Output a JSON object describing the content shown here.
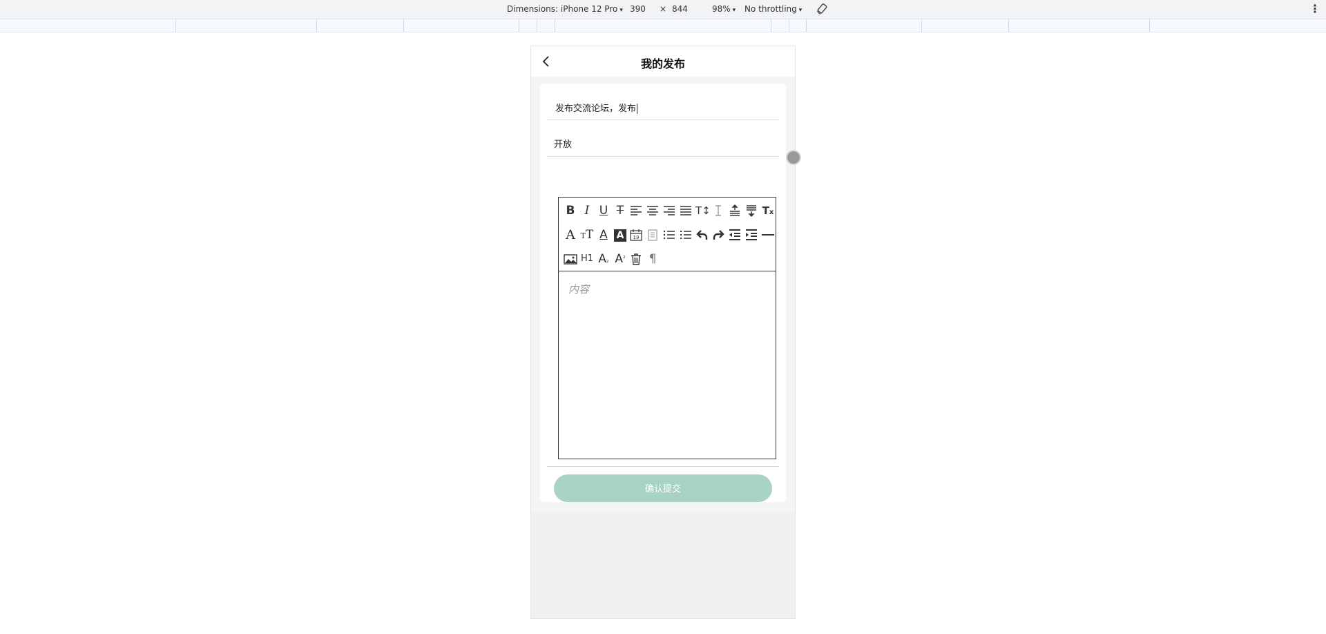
{
  "devtools": {
    "dimensions_label": "Dimensions: iPhone 12 Pro",
    "width": "390",
    "times": "×",
    "height": "844",
    "zoom": "98%",
    "throttling": "No throttling",
    "caret": "▾",
    "more": "⋮"
  },
  "nav": {
    "title": "我的发布"
  },
  "form": {
    "title_value": "发布交流论坛，发布",
    "status_value": "开放",
    "editor_placeholder": "内容",
    "submit_label": "确认提交"
  },
  "toolbar": {
    "row1": [
      "bold-icon",
      "italic-icon",
      "underline-icon",
      "strikethrough-icon",
      "align-left-icon",
      "align-center-icon",
      "align-right-icon",
      "align-justify-icon",
      "font-size-icon",
      "line-height-icon",
      "paragraph-spacing-above-icon",
      "paragraph-spacing-below-icon",
      "clear-format-icon"
    ],
    "row2": [
      "font-family-icon",
      "text-size-icon",
      "font-color-icon",
      "background-color-icon",
      "date-icon",
      "template-icon",
      "ordered-list-icon",
      "unordered-list-icon",
      "undo-icon",
      "redo-icon",
      "outdent-icon",
      "indent-icon",
      "horizontal-rule-icon"
    ],
    "row3": [
      "image-icon",
      "heading-icon",
      "subscript-icon",
      "superscript-icon",
      "delete-icon",
      "paragraph-mark-icon"
    ],
    "labels": {
      "h1": "H1"
    }
  },
  "colors": {
    "accent": "#a8d2c4",
    "knob": "#999999"
  }
}
